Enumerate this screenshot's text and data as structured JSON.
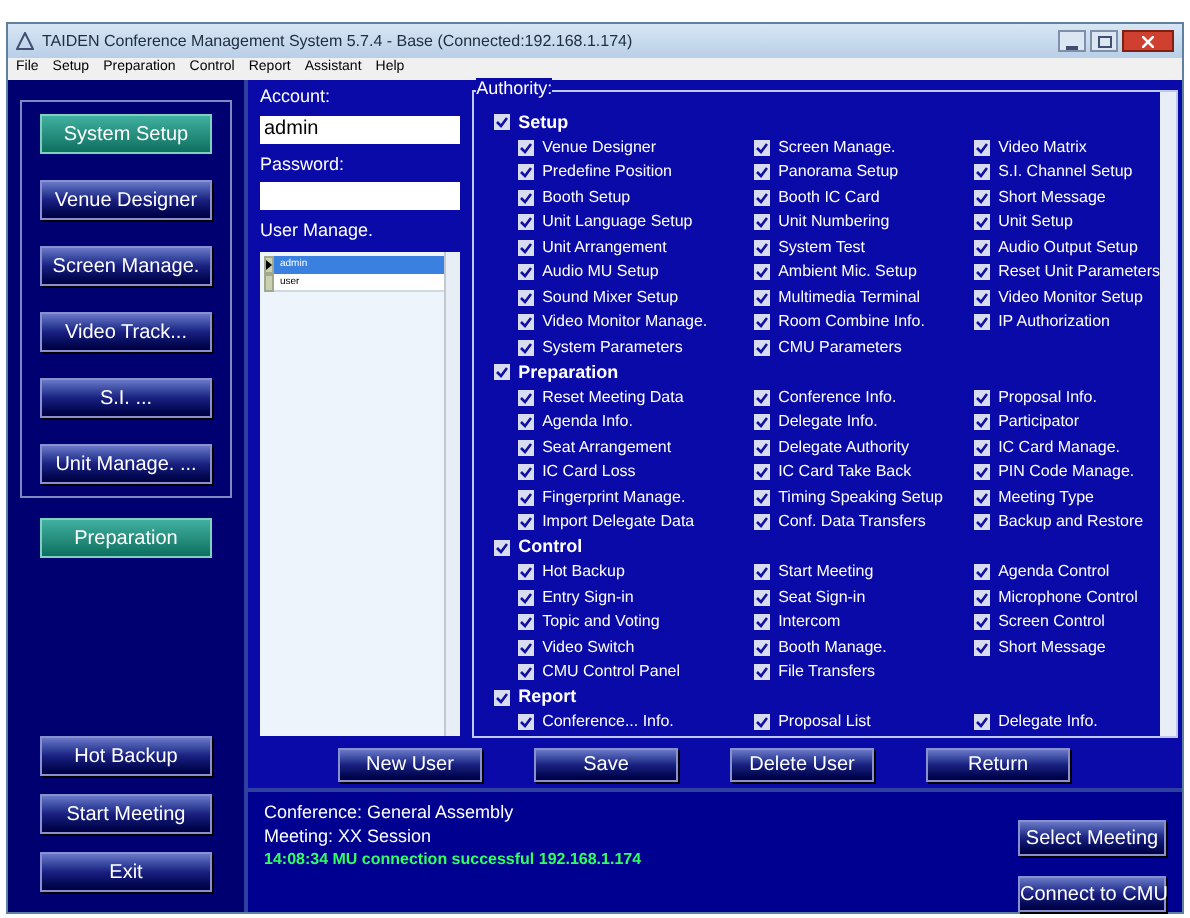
{
  "window": {
    "title": "TAIDEN Conference Management System 5.7.4 - Base (Connected:192.168.1.174)"
  },
  "menu": [
    "File",
    "Setup",
    "Preparation",
    "Control",
    "Report",
    "Assistant",
    "Help"
  ],
  "sidebar": {
    "group": [
      {
        "label": "System Setup",
        "selected": true
      },
      {
        "label": "Venue Designer",
        "selected": false
      },
      {
        "label": "Screen Manage.",
        "selected": false
      },
      {
        "label": "Video Track...",
        "selected": false
      },
      {
        "label": "S.I. ...",
        "selected": false
      },
      {
        "label": "Unit Manage. ...",
        "selected": false
      }
    ],
    "extra": [
      {
        "label": "Preparation",
        "selected": true
      }
    ],
    "bottom": [
      "Hot Backup",
      "Start Meeting",
      "Exit"
    ]
  },
  "account": {
    "label": "Account:",
    "value": "admin"
  },
  "password": {
    "label": "Password:"
  },
  "users": {
    "label": "User Manage.",
    "rows": [
      {
        "name": "admin",
        "selected": true
      },
      {
        "name": "user",
        "selected": false
      }
    ]
  },
  "authority": {
    "title": "Authority:",
    "sections": [
      {
        "label": "Setup",
        "checked": true,
        "items": [
          {
            "label": "Venue Designer",
            "checked": true
          },
          {
            "label": "Screen Manage.",
            "checked": true
          },
          {
            "label": "Video Matrix",
            "checked": true
          },
          {
            "label": "Predefine Position",
            "checked": true
          },
          {
            "label": "Panorama Setup",
            "checked": true
          },
          {
            "label": "S.I. Channel Setup",
            "checked": true
          },
          {
            "label": "Booth Setup",
            "checked": true
          },
          {
            "label": "Booth IC Card",
            "checked": true
          },
          {
            "label": "Short Message",
            "checked": true
          },
          {
            "label": "Unit Language Setup",
            "checked": true
          },
          {
            "label": "Unit Numbering",
            "checked": true
          },
          {
            "label": "Unit Setup",
            "checked": true
          },
          {
            "label": "Unit Arrangement",
            "checked": true
          },
          {
            "label": "System Test",
            "checked": true
          },
          {
            "label": "Audio Output Setup",
            "checked": true
          },
          {
            "label": "Audio MU Setup",
            "checked": true
          },
          {
            "label": "Ambient Mic. Setup",
            "checked": true
          },
          {
            "label": "Reset Unit Parameters",
            "checked": true
          },
          {
            "label": "Sound Mixer Setup",
            "checked": true
          },
          {
            "label": "Multimedia Terminal",
            "checked": true
          },
          {
            "label": "Video Monitor Setup",
            "checked": true
          },
          {
            "label": "Video Monitor Manage.",
            "checked": true
          },
          {
            "label": "Room Combine Info.",
            "checked": true
          },
          {
            "label": "IP Authorization",
            "checked": true
          },
          {
            "label": "System Parameters",
            "checked": true
          },
          {
            "label": "CMU Parameters",
            "checked": true
          }
        ]
      },
      {
        "label": "Preparation",
        "checked": true,
        "items": [
          {
            "label": "Reset Meeting Data",
            "checked": true
          },
          {
            "label": "Conference Info.",
            "checked": true
          },
          {
            "label": "Proposal Info.",
            "checked": true
          },
          {
            "label": "Agenda Info.",
            "checked": true
          },
          {
            "label": "Delegate Info.",
            "checked": true
          },
          {
            "label": "Participator",
            "checked": true
          },
          {
            "label": "Seat Arrangement",
            "checked": true
          },
          {
            "label": "Delegate Authority",
            "checked": true
          },
          {
            "label": "IC Card Manage.",
            "checked": true
          },
          {
            "label": "IC Card Loss",
            "checked": true
          },
          {
            "label": "IC Card Take Back",
            "checked": true
          },
          {
            "label": "PIN Code Manage.",
            "checked": true
          },
          {
            "label": "Fingerprint Manage.",
            "checked": true
          },
          {
            "label": "Timing Speaking Setup",
            "checked": true
          },
          {
            "label": "Meeting Type",
            "checked": true
          },
          {
            "label": "Import Delegate Data",
            "checked": true
          },
          {
            "label": "Conf. Data Transfers",
            "checked": true
          },
          {
            "label": "Backup and Restore",
            "checked": true
          }
        ]
      },
      {
        "label": "Control",
        "checked": true,
        "items": [
          {
            "label": "Hot Backup",
            "checked": true
          },
          {
            "label": "Start Meeting",
            "checked": true
          },
          {
            "label": "Agenda Control",
            "checked": true
          },
          {
            "label": "Entry Sign-in",
            "checked": true
          },
          {
            "label": "Seat Sign-in",
            "checked": true
          },
          {
            "label": "Microphone Control",
            "checked": true
          },
          {
            "label": "Topic and Voting",
            "checked": true
          },
          {
            "label": "Intercom",
            "checked": true
          },
          {
            "label": "Screen Control",
            "checked": true
          },
          {
            "label": "Video Switch",
            "checked": true
          },
          {
            "label": "Booth Manage.",
            "checked": true
          },
          {
            "label": "Short Message",
            "checked": true
          },
          {
            "label": "CMU Control Panel",
            "checked": true
          },
          {
            "label": "File Transfers",
            "checked": true
          }
        ]
      },
      {
        "label": "Report",
        "checked": true,
        "items": [
          {
            "label": "Conference... Info.",
            "checked": true
          },
          {
            "label": "Proposal List",
            "checked": true
          },
          {
            "label": "Delegate Info.",
            "checked": true
          }
        ]
      }
    ]
  },
  "actions": [
    "New User",
    "Save",
    "Delete User",
    "Return"
  ],
  "status": {
    "lines": [
      "Conference: General Assembly",
      "Meeting: XX Session"
    ],
    "log": "14:08:34 MU connection successful 192.168.1.174",
    "buttons": [
      "Select Meeting",
      "Connect to CMU"
    ]
  }
}
